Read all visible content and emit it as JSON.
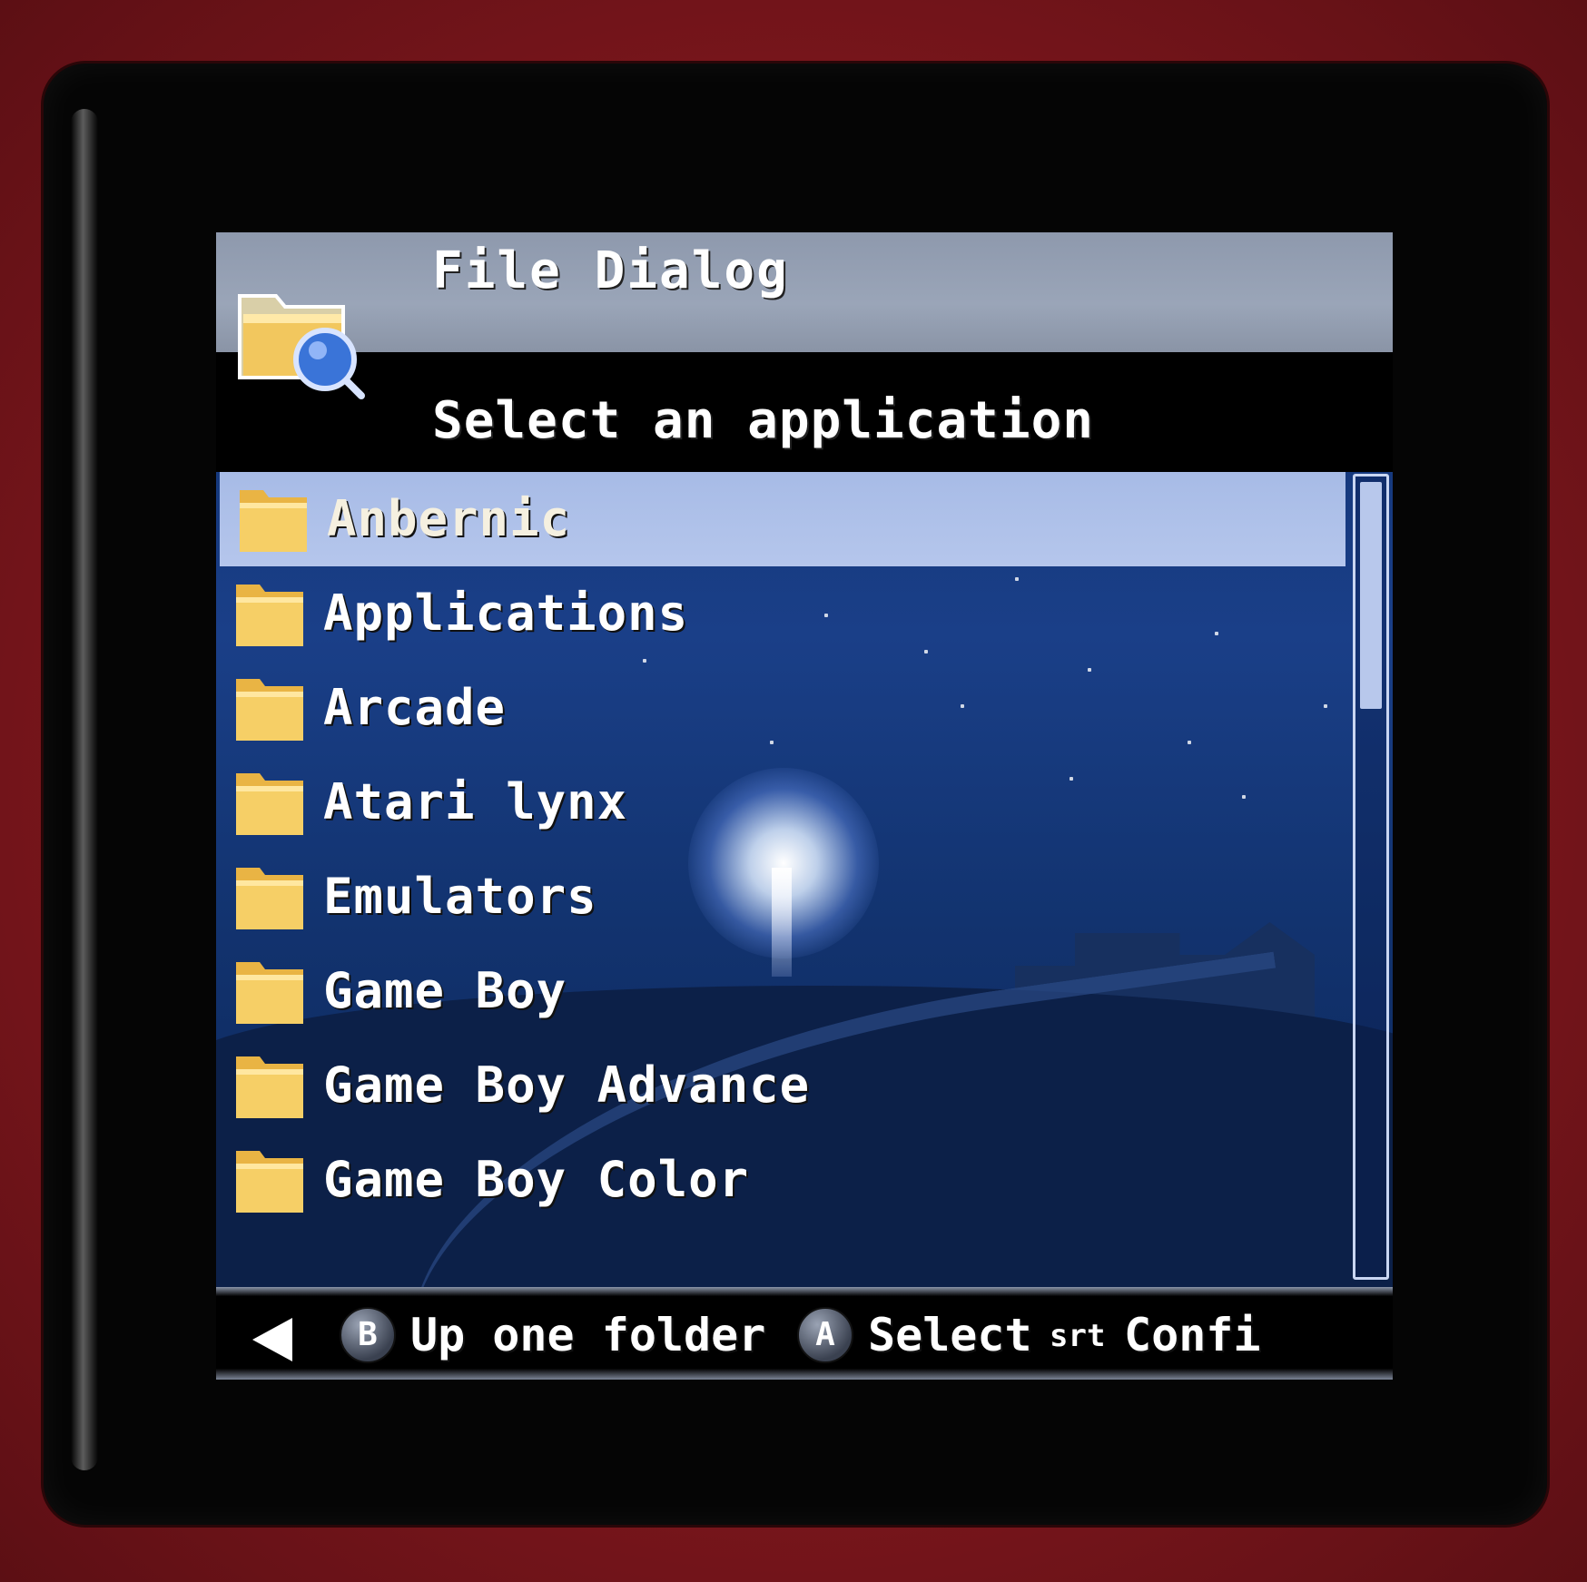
{
  "dialog": {
    "title": "File Dialog",
    "subtitle": "Select an application"
  },
  "list": {
    "items": [
      {
        "label": "Anbernic",
        "icon": "folder-icon",
        "selected": true
      },
      {
        "label": "Applications",
        "icon": "folder-icon",
        "selected": false
      },
      {
        "label": "Arcade",
        "icon": "folder-icon",
        "selected": false
      },
      {
        "label": "Atari lynx",
        "icon": "folder-icon",
        "selected": false
      },
      {
        "label": "Emulators",
        "icon": "folder-icon",
        "selected": false
      },
      {
        "label": "Game Boy",
        "icon": "folder-icon",
        "selected": false
      },
      {
        "label": "Game Boy Advance",
        "icon": "folder-icon",
        "selected": false
      },
      {
        "label": "Game Boy Color",
        "icon": "folder-icon",
        "selected": false
      }
    ],
    "scroll_position_fraction": 0
  },
  "footer": {
    "back_icon": "left-arrow-icon",
    "b_button": "B",
    "b_action": "Up one folder",
    "a_button": "A",
    "a_action": "Select",
    "start_button": "srt",
    "start_action": "Confi"
  },
  "colors": {
    "header_bar": "#9aa5b8",
    "selection": "#b0c2ea",
    "folder_yellow": "#f4c95a",
    "wallpaper": "#1a3f88"
  }
}
